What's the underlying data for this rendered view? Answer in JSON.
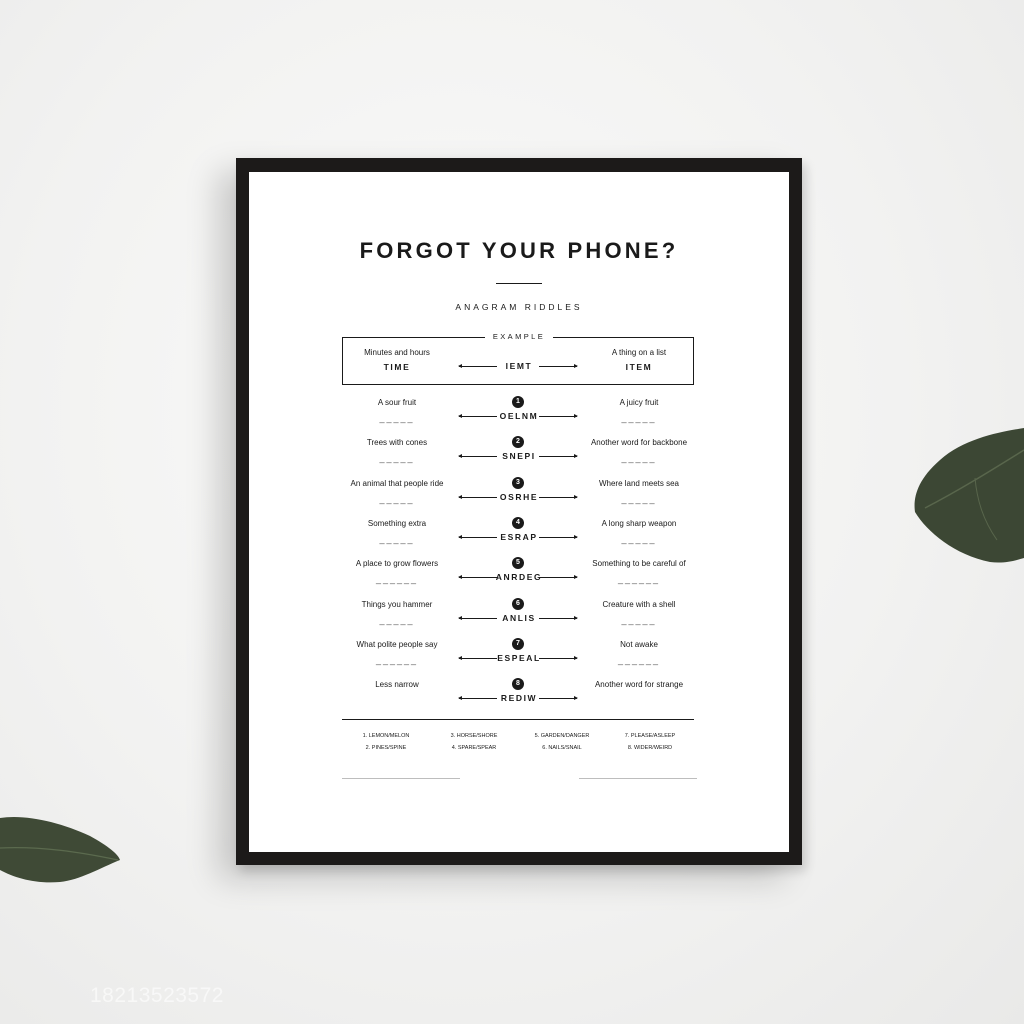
{
  "poster": {
    "title": "FORGOT YOUR PHONE?",
    "subtitle": "ANAGRAM RIDDLES",
    "example_label": "EXAMPLE",
    "example": {
      "clue_left": "Minutes and hours",
      "word_left": "TIME",
      "scramble": "IEMT",
      "clue_right": "A thing on a list",
      "word_right": "ITEM"
    },
    "riddles": [
      {
        "number": "1",
        "clue_left": "A sour fruit",
        "blank_left": "_____",
        "scramble": "OELNM",
        "clue_right": "A juicy fruit",
        "blank_right": "_____"
      },
      {
        "number": "2",
        "clue_left": "Trees with cones",
        "blank_left": "_____",
        "scramble": "SNEPI",
        "clue_right": "Another word for backbone",
        "blank_right": "_____"
      },
      {
        "number": "3",
        "clue_left": "An animal that people ride",
        "blank_left": "_____",
        "scramble": "OSRHE",
        "clue_right": "Where land meets sea",
        "blank_right": "_____"
      },
      {
        "number": "4",
        "clue_left": "Something extra",
        "blank_left": "_____",
        "scramble": "ESRAP",
        "clue_right": "A long sharp weapon",
        "blank_right": "_____"
      },
      {
        "number": "5",
        "clue_left": "A place to grow flowers",
        "blank_left": "______",
        "scramble": "ANRDEG",
        "clue_right": "Something to be careful of",
        "blank_right": "______"
      },
      {
        "number": "6",
        "clue_left": "Things you hammer",
        "blank_left": "_____",
        "scramble": "ANLIS",
        "clue_right": "Creature with a shell",
        "blank_right": "_____"
      },
      {
        "number": "7",
        "clue_left": "What polite people say",
        "blank_left": "______",
        "scramble": "ESPEAL",
        "clue_right": "Not awake",
        "blank_right": "______"
      },
      {
        "number": "8",
        "clue_left": "Less narrow",
        "blank_left": "",
        "scramble": "REDIW",
        "clue_right": "Another word for strange",
        "blank_right": ""
      }
    ],
    "answers": [
      "1. LEMON/MELON",
      "3. HORSE/SHORE",
      "5. GARDEN/DANGER",
      "7. PLEASE/ASLEEP",
      "2. PINES/SPINE",
      "4. SPARE/SPEAR",
      "6. NAILS/SNAIL",
      "8. WIDER/WEIRD"
    ]
  },
  "watermark": "18213523572",
  "colors": {
    "frame": "#1c1a19",
    "wall": "#f4f4f3",
    "leaf": "#3f4a36",
    "ink": "#1a1a1a"
  }
}
